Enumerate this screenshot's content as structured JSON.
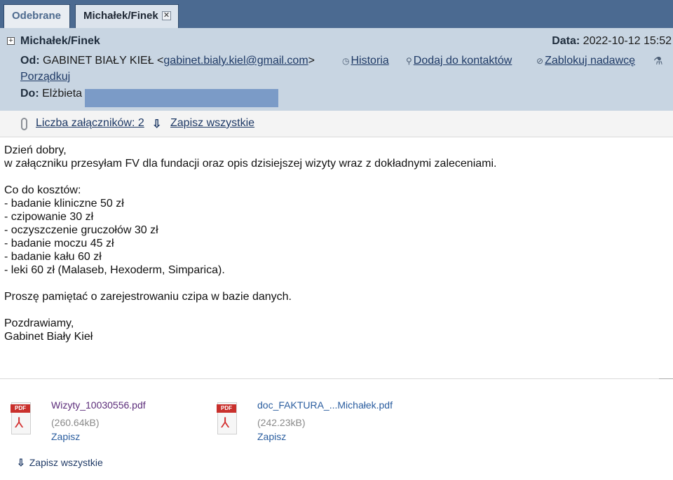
{
  "tabs": [
    {
      "label": "Odebrane"
    },
    {
      "label": "Michałek/Finek"
    }
  ],
  "tab_close_glyph": "✕",
  "header": {
    "subject": "Michałek/Finek",
    "date_label": "Data:",
    "date_value": "2022-10-12 15:52",
    "from_label": "Od:",
    "from_name": "GABINET BIAŁY KIEŁ <",
    "from_email": "gabinet.bialy.kiel@gmail.com",
    "from_close": ">",
    "to_label": "Do:",
    "to_name": "Elżbieta",
    "actions": {
      "history": "Historia",
      "add_contact": "Dodaj do kontaktów",
      "block_sender": "Zablokuj nadawcę",
      "organize": "Porządkuj"
    }
  },
  "attachments_bar": {
    "count_label": "Liczba załączników: 2",
    "save_all": "Zapisz wszystkie"
  },
  "message": {
    "lines": [
      "Dzień dobry,",
      "w załączniku przesyłam FV dla fundacji oraz opis dzisiejszej wizyty wraz z dokładnymi zaleceniami.",
      "",
      "Co do kosztów:",
      "- badanie kliniczne 50 zł",
      "- czipowanie 30 zł",
      "- oczyszczenie gruczołów 30 zł",
      "- badanie moczu 45 zł",
      "- badanie kału 60 zł",
      "- leki 60 zł (Malaseb, Hexoderm, Simparica).",
      "",
      "Proszę pamiętać o zarejestrowaniu czipa w bazie danych.",
      "",
      "Pozdrawiamy,",
      "Gabinet Biały Kieł"
    ]
  },
  "attachments": [
    {
      "name": "Wizyty_10030556.pdf",
      "size": "(260.64kB)",
      "save": "Zapisz",
      "tag": "PDF"
    },
    {
      "name": "doc_FAKTURA_...Michałek.pdf",
      "size": "(242.23kB)",
      "save": "Zapisz",
      "tag": "PDF"
    }
  ],
  "bottom_save_all": "Zapisz wszystkie",
  "colors": {
    "tabbar": "#4b6a91",
    "header_bg": "#c8d5e2",
    "link": "#1f3a66",
    "pdf_red": "#c9302c"
  }
}
